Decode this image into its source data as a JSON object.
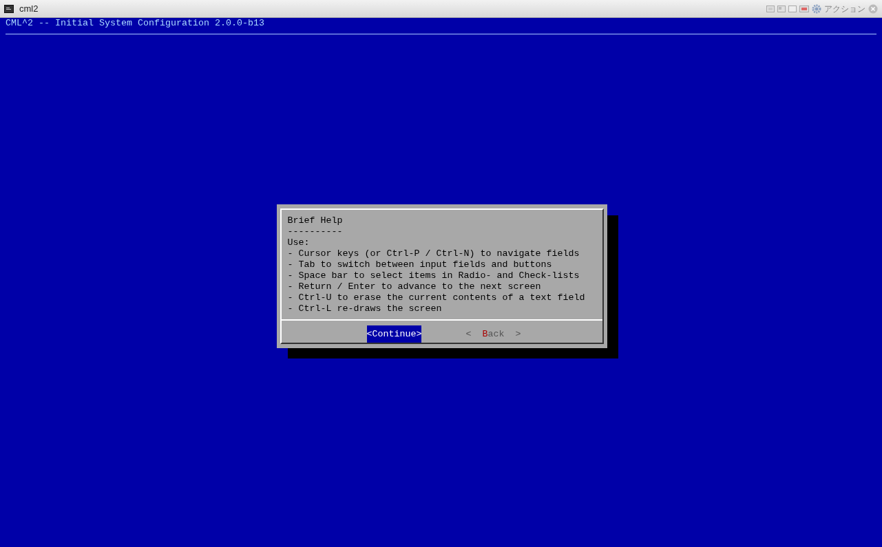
{
  "window": {
    "title": "cml2",
    "action_label": "アクション"
  },
  "screen": {
    "header": "CML^2 -- Initial System Configuration 2.0.0-b13"
  },
  "dialog": {
    "title": "Brief Help",
    "underline": "----------",
    "lines": [
      "Use:",
      "- Cursor keys (or Ctrl-P / Ctrl-N) to navigate fields",
      "- Tab to switch between input fields and buttons",
      "- Space bar to select items in Radio- and Check-lists",
      "- Return / Enter to advance to the next screen",
      "- Ctrl-U to erase the current contents of a text field",
      "- Ctrl-L re-draws the screen"
    ],
    "buttons": [
      {
        "open": "<",
        "label": "Continue",
        "close": ">",
        "selected": true
      },
      {
        "open": "<",
        "hotkey": "B",
        "label": "ack",
        "close": ">",
        "selected": false
      }
    ]
  }
}
